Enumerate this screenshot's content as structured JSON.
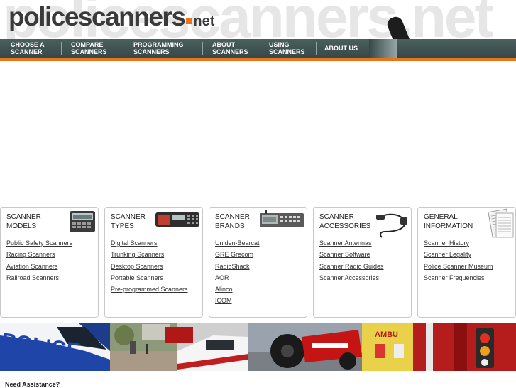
{
  "logo": {
    "bg_word": "policescanners.net",
    "name": "policescanners",
    "tld": "net"
  },
  "nav": [
    {
      "label": "CHOOSE A\nSCANNER"
    },
    {
      "label": "COMPARE\nSCANNERS"
    },
    {
      "label": "PROGRAMMING\nSCANNERS"
    },
    {
      "label": "ABOUT\nSCANNERS"
    },
    {
      "label": "USING\nSCANNERS"
    },
    {
      "label": "ABOUT US"
    }
  ],
  "categories": [
    {
      "title": "SCANNER\nMODELS",
      "icon": "handheld-scanner-icon",
      "links": [
        "Public Safety Scanners",
        "Racing Scanners",
        "Aviation Scanners",
        "Railroad Scanners"
      ]
    },
    {
      "title": "SCANNER\nTYPES",
      "icon": "desktop-scanner-icon",
      "links": [
        "Digital Scanners",
        "Trunking Scanners",
        "Desktop Scanners",
        "Portable Scanners",
        "Pre-programmed Scanners"
      ]
    },
    {
      "title": "SCANNER\nBRANDS",
      "icon": "base-scanner-icon",
      "links": [
        "Uniden-Bearcat",
        "GRE Grecom",
        "RadioShack",
        "AOR",
        "Alinco",
        "ICOM"
      ]
    },
    {
      "title": "SCANNER\nACCESSORIES",
      "icon": "power-cable-icon",
      "links": [
        "Scanner Antennas",
        "Scanner Software",
        "Scanner Radio Guides",
        "Scanner Accessories"
      ]
    },
    {
      "title": "GENERAL\nINFORMATION",
      "icon": "documents-icon",
      "links": [
        "Scanner History",
        "Scanner Legality",
        "Police Scanner Museum",
        "Scanner Frequencies"
      ]
    }
  ],
  "banner": {
    "police_text": "POLICE",
    "amb_text": "AMBU"
  },
  "footer": {
    "need_assistance": "Need Assistance?"
  },
  "colors": {
    "nav_bg": "#3f5252",
    "accent": "#e8741c"
  }
}
